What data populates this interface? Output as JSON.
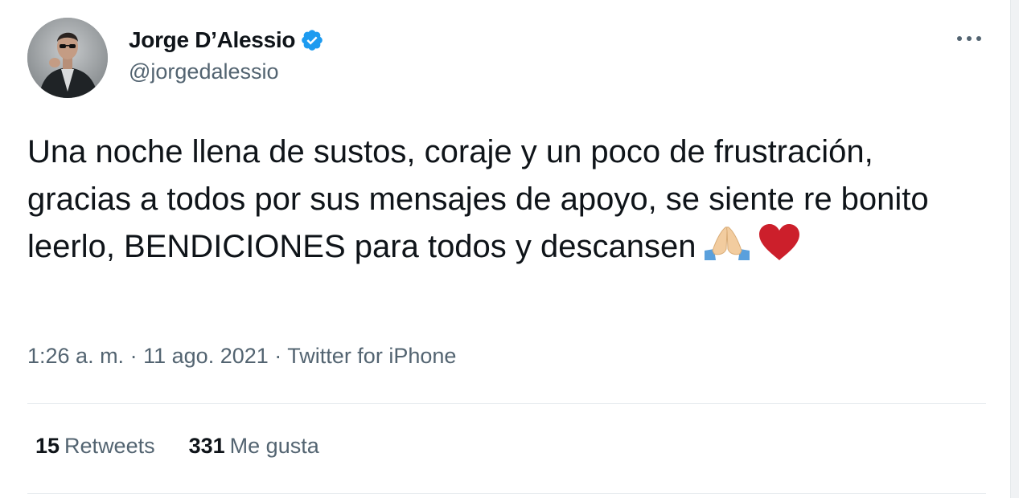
{
  "author": {
    "display_name": "Jorge D’Alessio",
    "handle": "@jorgedalessio",
    "verified": true,
    "verified_icon": "verified-badge-icon"
  },
  "menu": {
    "icon": "more-horizontal-icon"
  },
  "tweet": {
    "text": "Una noche llena de sustos, coraje y un poco de frustración, gracias a todos por sus mensajes de apoyo, se siente re bonito leerlo, BENDICIONES para todos y descansen",
    "emojis": [
      "folded-hands-emoji",
      "red-heart-emoji"
    ]
  },
  "meta": {
    "time": "1:26 a. m.",
    "separator": "·",
    "date": "11 ago. 2021",
    "source": "Twitter for iPhone"
  },
  "stats": {
    "retweets_count": "15",
    "retweets_label": "Retweets",
    "likes_count": "331",
    "likes_label": "Me gusta"
  },
  "colors": {
    "verified_blue": "#1d9bf0",
    "secondary_text": "#536471",
    "primary_text": "#0f1419",
    "heart_red": "#cc1f2b",
    "divider": "#e6ebee"
  }
}
